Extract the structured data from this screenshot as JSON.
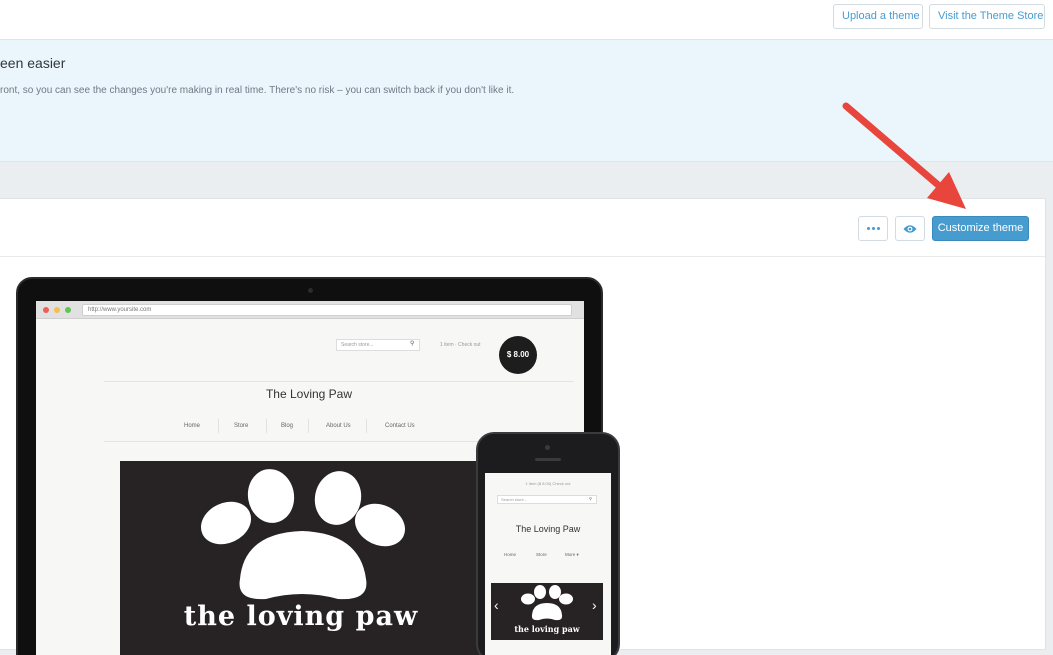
{
  "topbar": {
    "upload_label": "Upload a theme",
    "store_label": "Visit the Theme Store"
  },
  "banner": {
    "title": "een easier",
    "text": "ront, so you can see the changes you're making in real time. There's no risk – you can switch back if you don't like it."
  },
  "card": {
    "more_icon": "ellipsis-icon",
    "preview_icon": "eye-icon",
    "customize_label": "Customize theme"
  },
  "preview": {
    "url": "http://www.yoursite.com",
    "search_placeholder": "Search store...",
    "cart_text": "1 item · Check out",
    "price": "$ 8.00",
    "site_title": "The Loving Paw",
    "nav": [
      "Home",
      "Store",
      "Blog",
      "About Us",
      "Contact Us"
    ],
    "hero_text": "the loving paw",
    "heart_color": "#e8412e"
  },
  "phone": {
    "cart_text": "1 item ($ 8.00)   Check out",
    "search_placeholder": "Search store...",
    "site_title": "The Loving Paw",
    "nav": [
      "Home",
      "Store",
      "More ▾"
    ],
    "hero_text": "the loving paw"
  },
  "colors": {
    "accent": "#479ccf",
    "annotation_arrow": "#e8453c"
  }
}
